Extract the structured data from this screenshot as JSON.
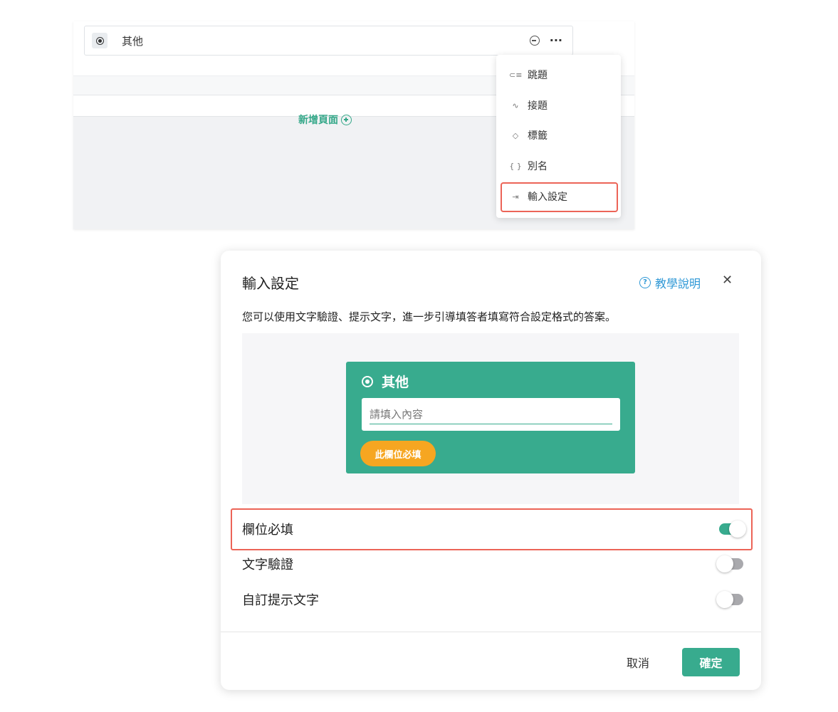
{
  "editor": {
    "option_label": "其他",
    "option_icon": "radio-icon",
    "remove_icon": "minus-circle-icon",
    "more_icon": "more-dots-icon",
    "more_glyph": "···",
    "add_page_label": "新增頁面"
  },
  "dropdown": {
    "items": [
      {
        "label": "跳題",
        "icon": "jump-icon",
        "glyph": "⊂≡"
      },
      {
        "label": "接題",
        "icon": "connect-icon",
        "glyph": "∿"
      },
      {
        "label": "標籤",
        "icon": "tag-icon",
        "glyph": "◇"
      },
      {
        "label": "別名",
        "icon": "alias-icon",
        "glyph": "{ }"
      },
      {
        "label": "輸入設定",
        "icon": "input-setting-icon",
        "glyph": "⇥"
      }
    ],
    "highlighted": "輸入設定"
  },
  "modal": {
    "title": "輸入設定",
    "help_label": "教學說明",
    "help_glyph": "?",
    "close_glyph": "✕",
    "description": "您可以使用文字驗證、提示文字，進一步引導填答者填寫符合設定格式的答案。",
    "preview": {
      "option_label": "其他",
      "input_placeholder": "請填入內容",
      "required_badge": "此欄位必填"
    },
    "settings": [
      {
        "label": "欄位必填",
        "enabled": true
      },
      {
        "label": "文字驗證",
        "enabled": false
      },
      {
        "label": "自訂提示文字",
        "enabled": false
      }
    ],
    "cancel_label": "取消",
    "confirm_label": "確定"
  },
  "colors": {
    "accent": "#38ab8e",
    "highlight_border": "#ec6457",
    "badge": "#f6a621",
    "link": "#2f98d6"
  }
}
